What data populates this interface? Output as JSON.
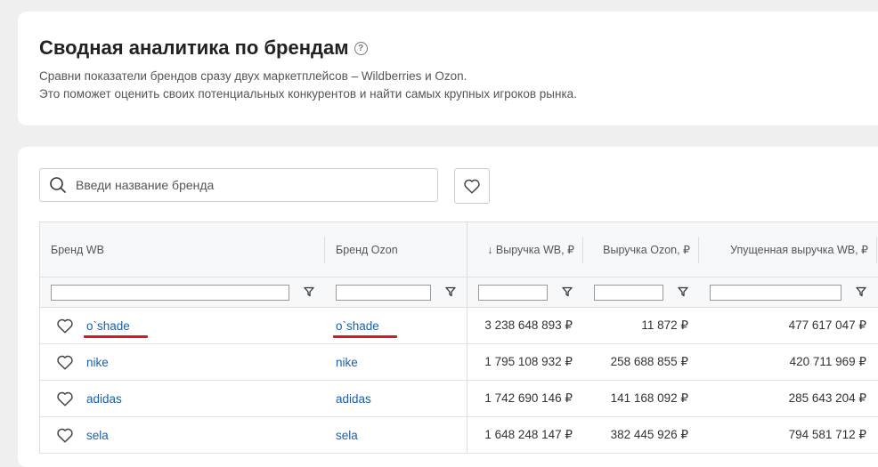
{
  "header": {
    "title": "Сводная аналитика по брендам",
    "help_icon": "help-circle-icon",
    "subtitle_line1": "Сравни показатели брендов сразу двух маркетплейсов – Wildberries и Ozon.",
    "subtitle_line2": "Это поможет оценить своих потенциальных конкурентов и найти самых крупных игроков рынка."
  },
  "search": {
    "placeholder": "Введи название бренда",
    "icon": "search-icon"
  },
  "favorites_button": {
    "icon": "heart-outline-icon"
  },
  "table": {
    "columns": [
      "Бренд WB",
      "Бренд Ozon",
      "↓ Выручка WB, ₽",
      "Выручка Ozon, ₽",
      "Упущенная выручка WB, ₽"
    ],
    "rows": [
      {
        "brand_wb": "o`shade",
        "brand_ozon": "o`shade",
        "revenue_wb": "3 238 648 893 ₽",
        "revenue_ozon": "11 872 ₽",
        "lost_revenue_wb": "477 617 047 ₽",
        "highlighted": true
      },
      {
        "brand_wb": "nike",
        "brand_ozon": "nike",
        "revenue_wb": "1 795 108 932 ₽",
        "revenue_ozon": "258 688 855 ₽",
        "lost_revenue_wb": "420 711 969 ₽"
      },
      {
        "brand_wb": "adidas",
        "brand_ozon": "adidas",
        "revenue_wb": "1 742 690 146 ₽",
        "revenue_ozon": "141 168 092 ₽",
        "lost_revenue_wb": "285 643 204 ₽"
      },
      {
        "brand_wb": "sela",
        "brand_ozon": "sela",
        "revenue_wb": "1 648 248 147 ₽",
        "revenue_ozon": "382 445 926 ₽",
        "lost_revenue_wb": "794 581 712 ₽"
      }
    ]
  },
  "colors": {
    "link": "#1a5fa8",
    "highlight_underline": "#d9191f",
    "background": "#efefef"
  }
}
